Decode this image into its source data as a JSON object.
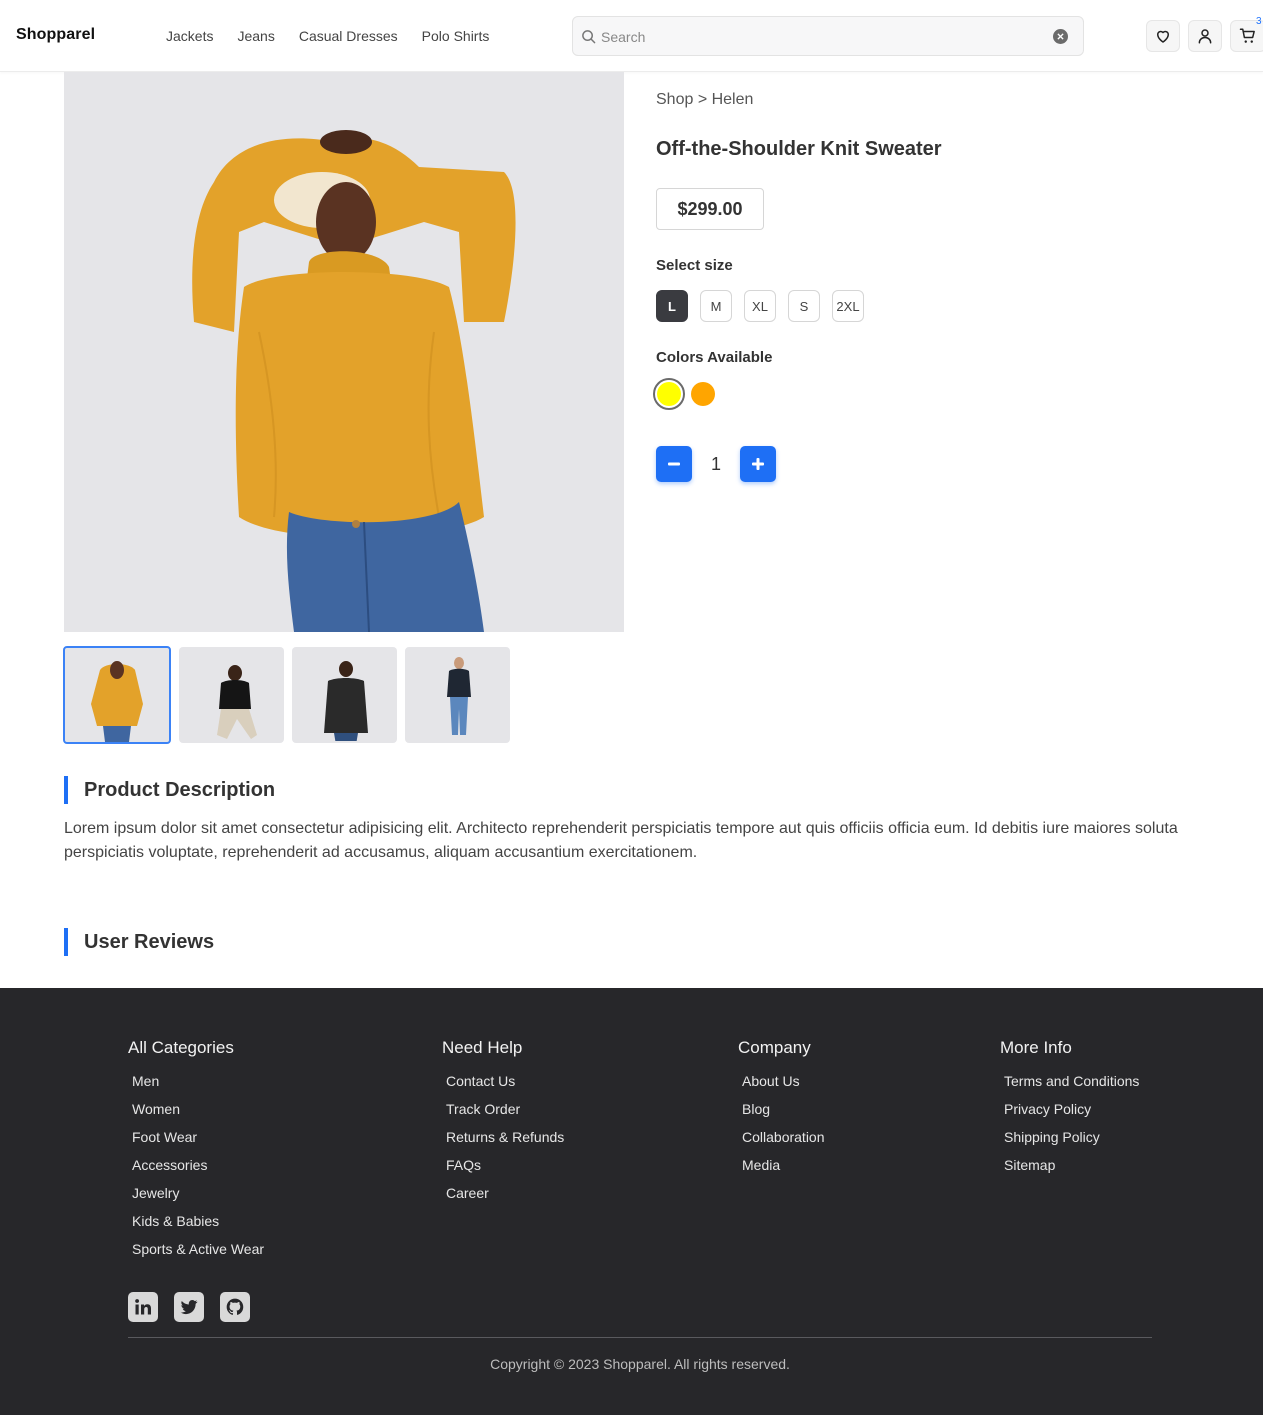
{
  "header": {
    "logo": "Shopparel",
    "nav": [
      "Jackets",
      "Jeans",
      "Casual Dresses",
      "Polo Shirts"
    ],
    "search_placeholder": "Search",
    "cart_count": "3"
  },
  "product": {
    "breadcrumb": "Shop > Helen",
    "title": "Off-the-Shoulder Knit Sweater",
    "price": "$299.00",
    "size_label": "Select size",
    "sizes": [
      "L",
      "M",
      "XL",
      "S",
      "2XL"
    ],
    "selected_size": "L",
    "colors_label": "Colors Available",
    "colors": [
      "#ffff00",
      "#ffa500"
    ],
    "selected_color": "#ffff00",
    "quantity": "1"
  },
  "gallery": {
    "thumbnails": [
      "yellow-sweater-woman",
      "man-black-tshirt-sitting",
      "man-leather-jacket",
      "man-navy-jacket-jeans"
    ],
    "active_thumbnail": 0
  },
  "description": {
    "heading": "Product Description",
    "text": "Lorem ipsum dolor sit amet consectetur adipisicing elit. Architecto reprehenderit perspiciatis tempore aut quis officiis officia eum. Id debitis iure maiores soluta perspiciatis voluptate, reprehenderit ad accusamus, aliquam accusantium exercitationem."
  },
  "reviews": {
    "heading": "User Reviews"
  },
  "footer": {
    "columns": [
      {
        "title": "All Categories",
        "links": [
          "Men",
          "Women",
          "Foot Wear",
          "Accessories",
          "Jewelry",
          "Kids & Babies",
          "Sports & Active Wear"
        ]
      },
      {
        "title": "Need Help",
        "links": [
          "Contact Us",
          "Track Order",
          "Returns & Refunds",
          "FAQs",
          "Career"
        ]
      },
      {
        "title": "Company",
        "links": [
          "About Us",
          "Blog",
          "Collaboration",
          "Media"
        ]
      },
      {
        "title": "More Info",
        "links": [
          "Terms and Conditions",
          "Privacy Policy",
          "Shipping Policy",
          "Sitemap"
        ]
      }
    ],
    "socials": [
      "linkedin-icon",
      "twitter-icon",
      "github-icon"
    ],
    "copyright": "Copyright © 2023 Shopparel. All rights reserved."
  },
  "colors": {
    "accent": "#1e6ff5",
    "footer_bg": "#27272a",
    "gallery_bg": "#e5e5e8"
  }
}
